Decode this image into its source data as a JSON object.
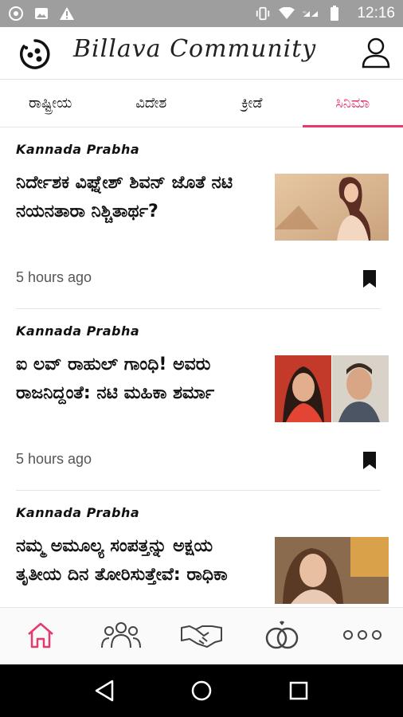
{
  "status_bar": {
    "time": "12:16",
    "network": "4G",
    "icons": [
      "chrome-icon",
      "image-icon",
      "warning-icon",
      "vibrate-icon",
      "wifi-icon",
      "signal-icon",
      "battery-icon"
    ]
  },
  "header": {
    "title": "Billava Community",
    "logo_icon": "community-logo",
    "profile_icon": "person-icon"
  },
  "tabs": [
    {
      "label": "ರಾಷ್ಟ್ರೀಯ",
      "active": false
    },
    {
      "label": "ವಿದೇಶ",
      "active": false
    },
    {
      "label": "ಕ್ರೀಡೆ",
      "active": false
    },
    {
      "label": "ಸಿನಿಮಾ",
      "active": true
    }
  ],
  "articles": [
    {
      "source": "Kannada Prabha",
      "headline": "ನಿರ್ದೇಶಕ ವಿಘ್ನೇಶ್ ಶಿವನ್ ಜೊತೆ ನಟಿ ನಯನತಾರಾ ನಿಶ್ಚಿತಾರ್ಥ?",
      "time": "5 hours ago"
    },
    {
      "source": "Kannada Prabha",
      "headline": "ಐ ಲವ್ ರಾಹುಲ್ ಗಾಂಧಿ! ಅವರು ರಾಜನಿದ್ದಂತೆ: ನಟಿ ಮಹಿಕಾ ಶರ್ಮಾ",
      "time": "5 hours ago"
    },
    {
      "source": "Kannada Prabha",
      "headline": "ನಮ್ಮ ಅಮೂಲ್ಯ ಸಂಪತ್ತನ್ನು ಅಕ್ಷಯ ತೃತೀಯ ದಿನ ತೋರಿಸುತ್ತೇವೆ: ರಾಧಿಕಾ",
      "time": ""
    }
  ],
  "bottom_nav": [
    "home-icon",
    "community-icon",
    "handshake-icon",
    "rings-icon",
    "more-icon"
  ],
  "colors": {
    "accent": "#e6396d",
    "status_bar": "#9e9e9e",
    "system_nav": "#000000"
  }
}
